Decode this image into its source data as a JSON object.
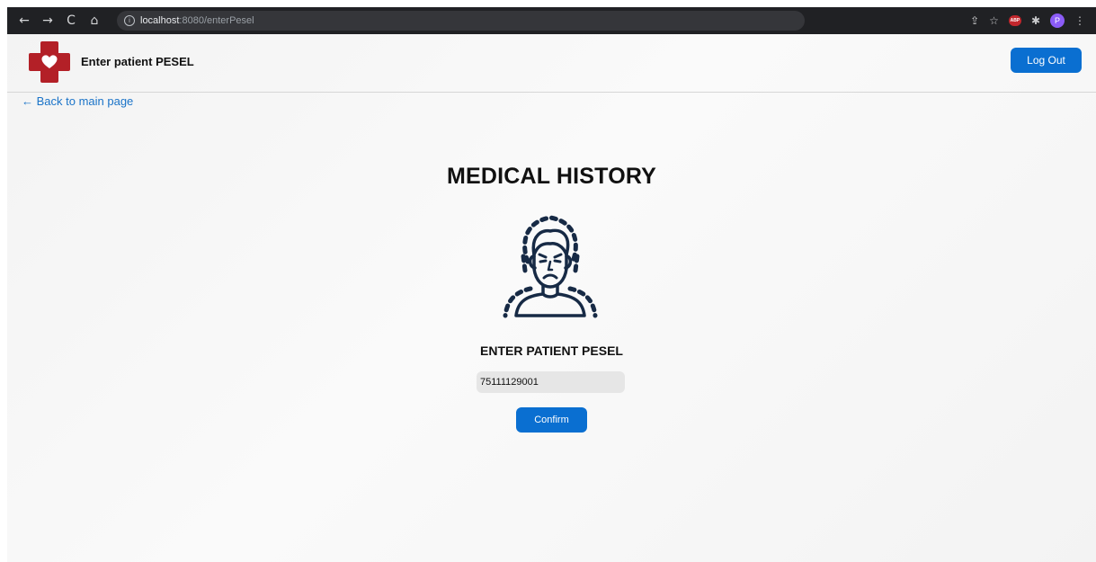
{
  "browser": {
    "back_glyph": "←",
    "forward_glyph": "→",
    "reload_glyph": "C",
    "home_glyph": "⌂",
    "info_glyph": "i",
    "url_host": "localhost",
    "url_path": ":8080/enterPesel",
    "share_glyph": "⇪",
    "star_glyph": "☆",
    "abp_label": "ABP",
    "extensions_glyph": "✱",
    "profile_initial": "P",
    "menu_glyph": "⋮"
  },
  "header": {
    "title": "Enter patient PESEL",
    "logout_label": "Log Out"
  },
  "nav": {
    "back_link": "← Back to main page"
  },
  "main": {
    "title": "MEDICAL HISTORY",
    "icon": "sick-patient-icon",
    "subtitle": "ENTER PATIENT PESEL",
    "pesel_value": "75111129001",
    "confirm_label": "Confirm"
  },
  "colors": {
    "primary": "#0a6fd1",
    "logo_red": "#b32027",
    "link": "#1a73c8"
  }
}
